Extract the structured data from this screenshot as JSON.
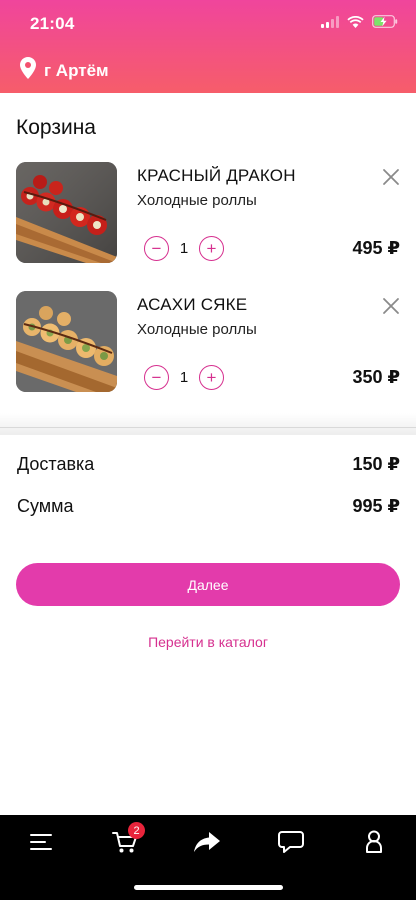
{
  "status_bar": {
    "time": "21:04"
  },
  "location": {
    "label": "г Артём",
    "icon": "map-pin-icon"
  },
  "cart": {
    "title": "Корзина",
    "items": [
      {
        "name": "КРАСНЫЙ ДРАКОН",
        "category": "Холодные роллы",
        "quantity": "1",
        "price": "495 ₽"
      },
      {
        "name": "АСАХИ СЯКЕ",
        "category": "Холодные роллы",
        "quantity": "1",
        "price": "350 ₽"
      }
    ]
  },
  "summary": {
    "delivery_label": "Доставка",
    "delivery_value": "150 ₽",
    "total_label": "Сумма",
    "total_value": "995 ₽"
  },
  "actions": {
    "next_label": "Далее",
    "catalog_link": "Перейти в каталог"
  },
  "tabbar": {
    "cart_badge": "2",
    "tabs": [
      "menu-icon",
      "cart-icon",
      "share-icon",
      "chat-icon",
      "profile-icon"
    ]
  },
  "colors": {
    "accent": "#e33bab",
    "header_top": "#f0459c",
    "header_bottom": "#f65d6a",
    "badge": "#e8243b"
  }
}
